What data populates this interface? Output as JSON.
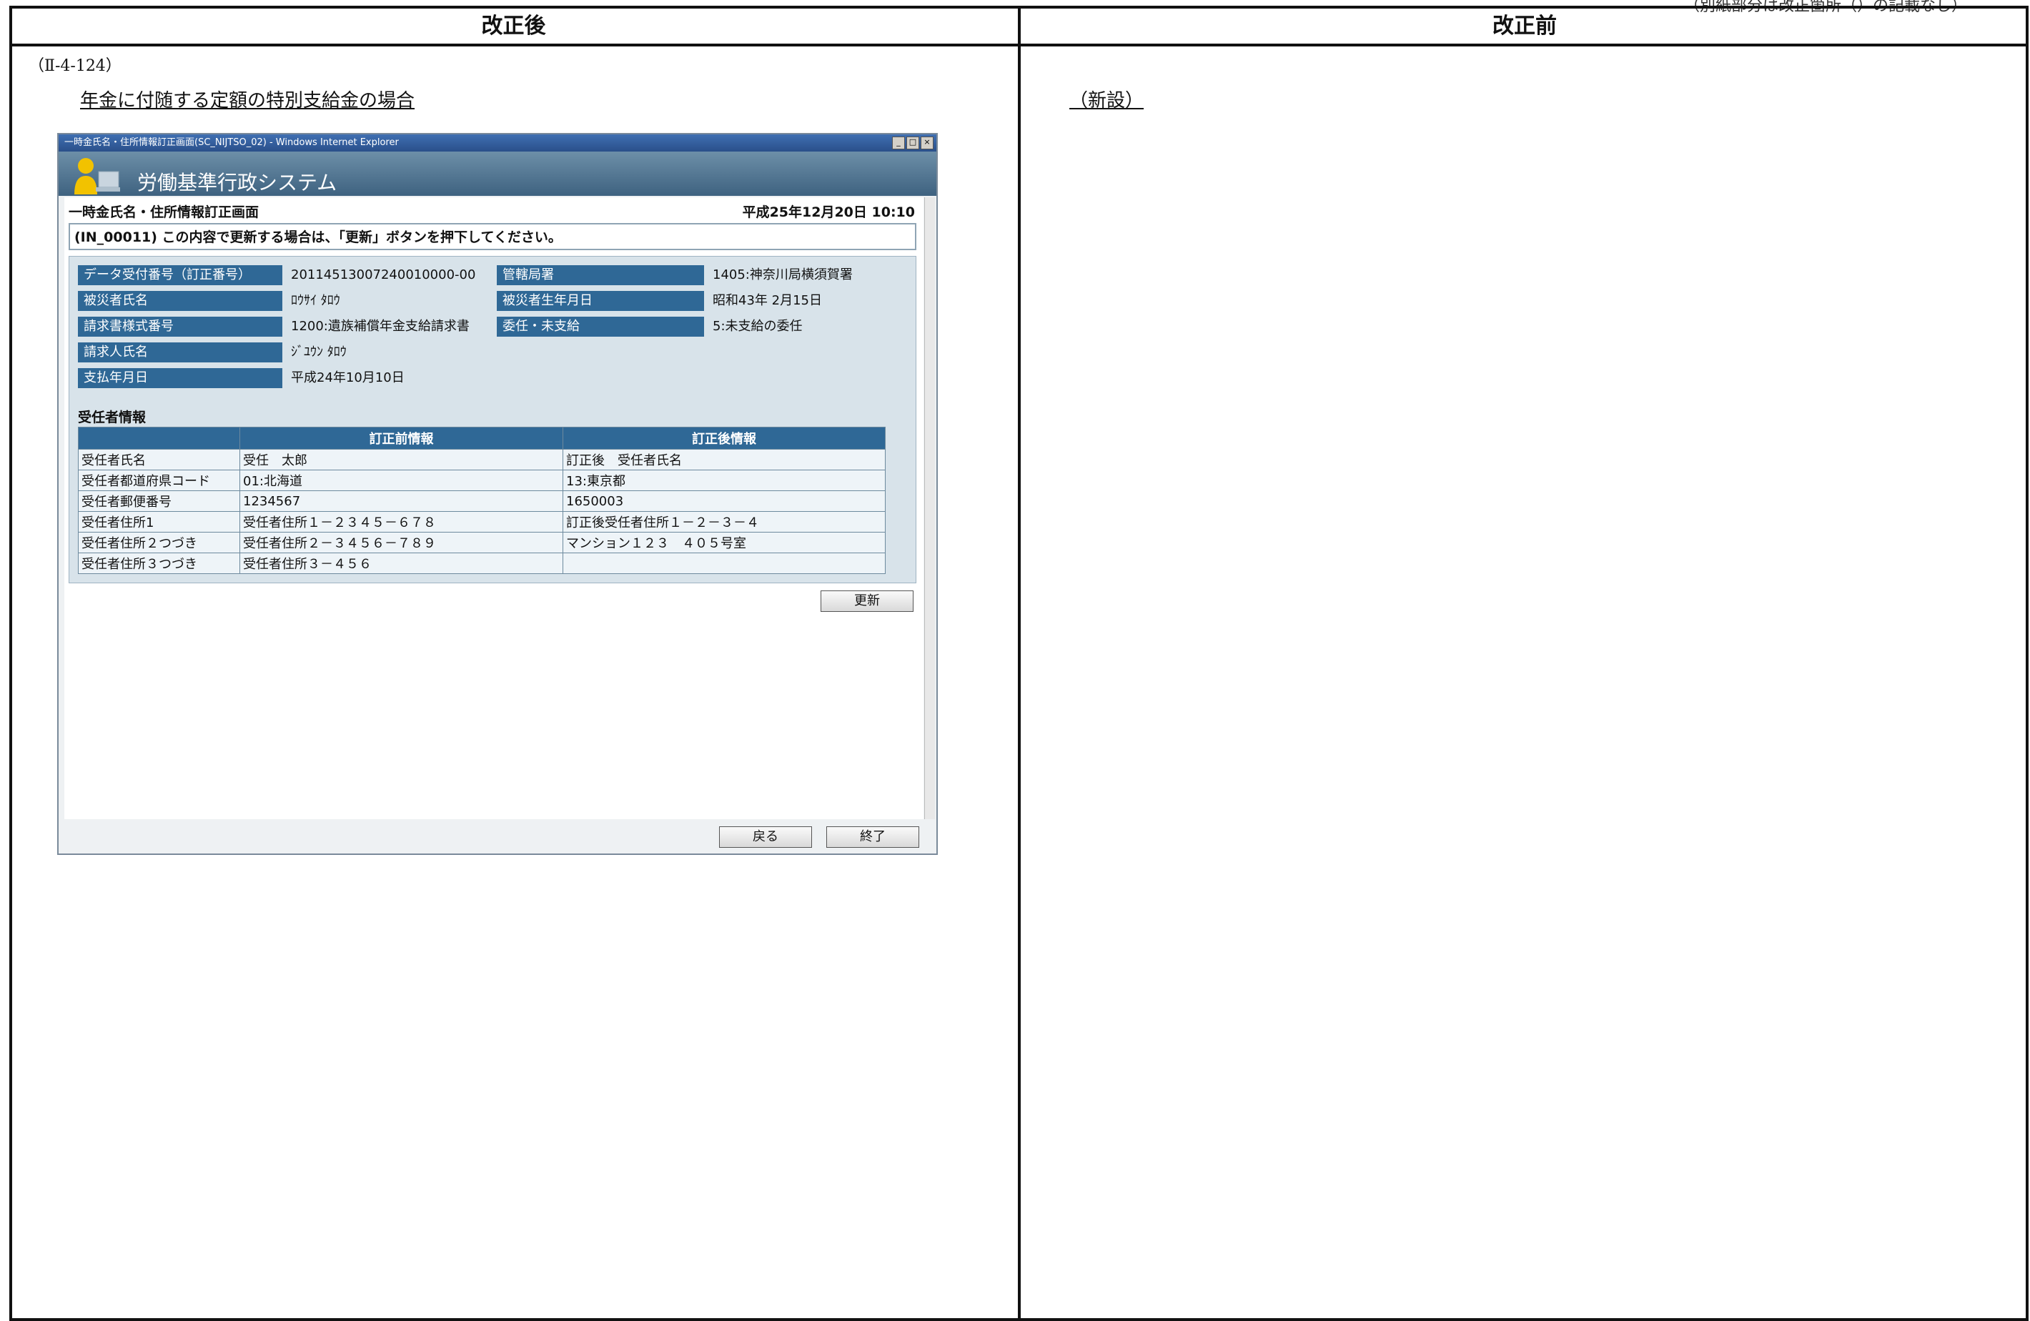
{
  "doc": {
    "top_note": "（別紙部分は改正箇所（）の記載なし）",
    "col_after": "改正後",
    "col_before": "改正前",
    "section_no": "（Ⅱ-4-124）",
    "case_title": "年金に付随する定額の特別支給金の場合",
    "new_note": "（新設）"
  },
  "window": {
    "title": "一時金氏名・住所情報訂正画面(SC_NIJTSO_02) - Windows Internet Explorer",
    "ctrl_min": "_",
    "ctrl_max": "□",
    "ctrl_close": "×",
    "app_name": "労働基準行政システム",
    "screen_title": "一時金氏名・住所情報訂正画面",
    "screen_date": "平成25年12月20日 10:10",
    "message": "(IN_00011) この内容で更新する場合は、「更新」ボタンを押下してください。"
  },
  "fields": {
    "receipt_no_label": "データ受付番号（訂正番号）",
    "receipt_no_value": "20114513007240010000-00",
    "office_label": "管轄局署",
    "office_value": "1405:神奈川局横須賀署",
    "victim_name_label": "被災者氏名",
    "victim_name_value": "ﾛｳｻｲ ﾀﾛｳ",
    "victim_birth_label": "被災者生年月日",
    "victim_birth_value": "昭和43年 2月15日",
    "form_no_label": "請求書様式番号",
    "form_no_value": "1200:遺族補償年金支給請求書",
    "delegation_label": "委任・未支給",
    "delegation_value": "5:未支給の委任",
    "claimant_label": "請求人氏名",
    "claimant_value": "ｼﾞﾕｳﾝ ﾀﾛｳ",
    "payment_date_label": "支払年月日",
    "payment_date_value": "平成24年10月10日"
  },
  "recipient": {
    "heading": "受任者情報",
    "col_before": "訂正前情報",
    "col_after": "訂正後情報",
    "rows": [
      {
        "label": "受任者氏名",
        "before": "受任　太郎",
        "after": "訂正後　受任者氏名"
      },
      {
        "label": "受任者都道府県コード",
        "before": "01:北海道",
        "after": "13:東京都"
      },
      {
        "label": "受任者郵便番号",
        "before": "1234567",
        "after": "1650003"
      },
      {
        "label": "受任者住所1",
        "before": "受任者住所１－２３４５－６７８",
        "after": "訂正後受任者住所１－２－３－４"
      },
      {
        "label": "受任者住所２つづき",
        "before": "受任者住所２－３４５６－７８９",
        "after": "マンション１２３　４０５号室"
      },
      {
        "label": "受任者住所３つづき",
        "before": "受任者住所３－４５６",
        "after": ""
      }
    ]
  },
  "buttons": {
    "update": "更新",
    "back": "戻る",
    "exit": "終了"
  }
}
